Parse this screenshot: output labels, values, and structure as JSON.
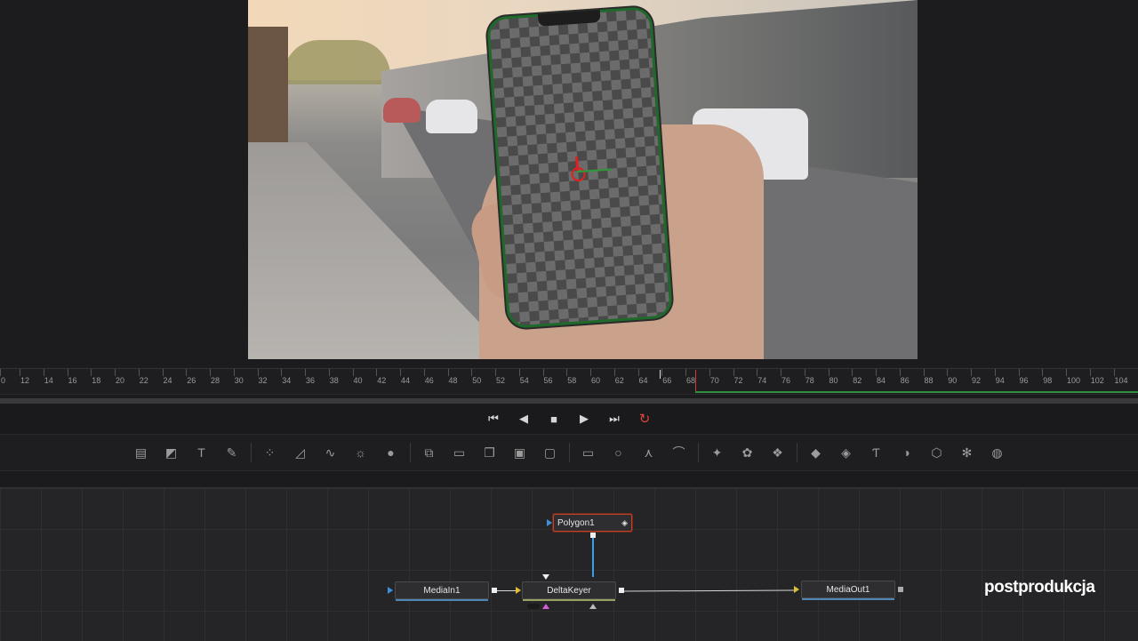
{
  "timeline": {
    "ticks": [
      "0",
      "12",
      "14",
      "16",
      "18",
      "20",
      "22",
      "24",
      "26",
      "28",
      "30",
      "32",
      "34",
      "36",
      "38",
      "40",
      "42",
      "44",
      "46",
      "48",
      "50",
      "52",
      "54",
      "56",
      "58",
      "60",
      "62",
      "64",
      "66",
      "68",
      "70",
      "72",
      "74",
      "76",
      "78",
      "80",
      "82",
      "84",
      "86",
      "88",
      "90",
      "92",
      "94",
      "96",
      "98",
      "100",
      "102",
      "104"
    ]
  },
  "transport": {
    "first": "⏮",
    "prev": "◀",
    "stop": "■",
    "play": "▶",
    "last": "⏭",
    "loop": "↻"
  },
  "toolbar": {
    "tools": [
      "▤",
      "◩",
      "T",
      "✎",
      "⁘",
      "◿",
      "∿",
      "☼",
      "●",
      "⧉",
      "▭",
      "❐",
      "▣",
      "▢",
      "▭",
      "○",
      "⋏",
      "⌒",
      "✦",
      "✿",
      "❖",
      "◆",
      "◈",
      "Ƭ",
      "◑",
      "⬡",
      "✻",
      "◍"
    ]
  },
  "nodes": {
    "polygon": "Polygon1",
    "media_in": "MediaIn1",
    "delta_keyer": "DeltaKeyer",
    "media_out": "MediaOut1"
  },
  "brand": "postprodukcja"
}
